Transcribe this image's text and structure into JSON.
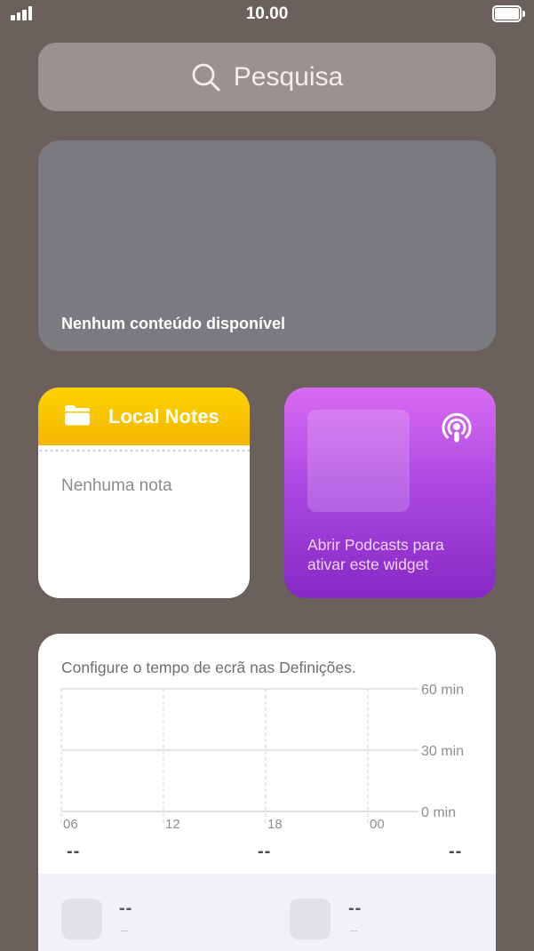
{
  "status_bar": {
    "time": "10.00"
  },
  "search": {
    "placeholder": "Pesquisa"
  },
  "empty_widget": {
    "label": "Nenhum conteúdo disponível"
  },
  "notes_widget": {
    "title": "Local Notes",
    "empty_text": "Nenhuma nota",
    "accent_color": "#f8c400"
  },
  "podcasts_widget": {
    "message": "Abrir Podcasts para ativar este widget",
    "accent_color": "#a946e0"
  },
  "screen_time_widget": {
    "title": "Configure o tempo de ecrã nas Definições.",
    "y_labels": [
      "60 min",
      "30 min",
      "0 min"
    ],
    "x_labels": [
      "06",
      "12",
      "18",
      "00"
    ],
    "summaries": [
      "--",
      "--",
      "--"
    ],
    "apps": [
      {
        "value": "--",
        "sub": "--"
      },
      {
        "value": "--",
        "sub": "--"
      }
    ]
  }
}
